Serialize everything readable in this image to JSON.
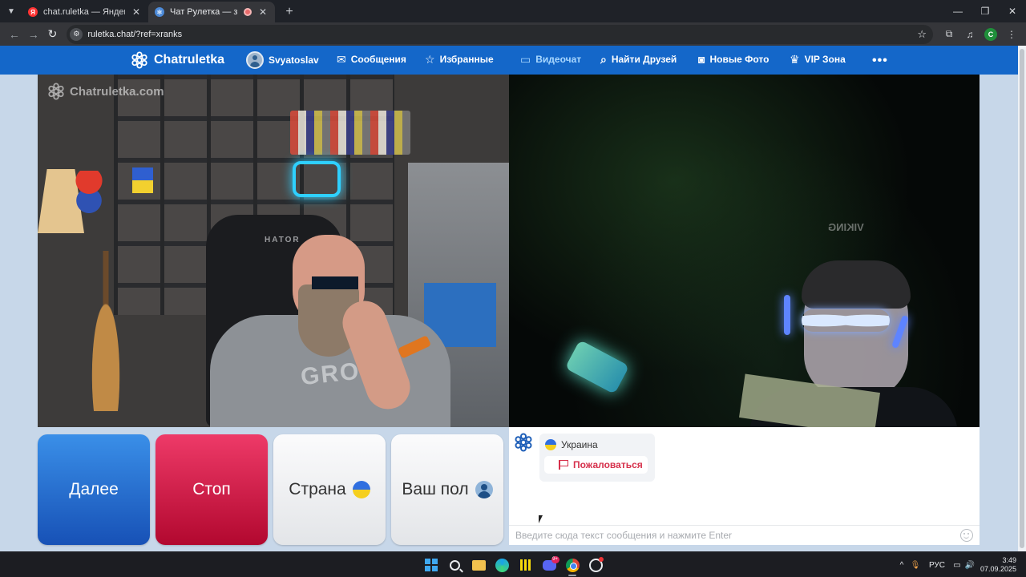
{
  "browser": {
    "tabs": [
      {
        "title": "chat.ruletka — Яндекс: нашлось",
        "active": false,
        "favicon": "yandex-icon"
      },
      {
        "title": "Чат Рулетка — знакомства",
        "active": true,
        "favicon": "chatruletka-icon",
        "recording": true
      }
    ],
    "url": "ruletka.chat/?ref=xranks",
    "profile_letter": "C"
  },
  "site": {
    "brand": "Chatruletka",
    "user_name": "Svyatoslav",
    "nav": [
      {
        "label": "Сообщения",
        "icon": "envelope-icon"
      },
      {
        "label": "Избранные",
        "icon": "star-icon"
      },
      {
        "label": "Видеочат",
        "icon": "video-camera-icon",
        "active": true
      },
      {
        "label": "Найти Друзей",
        "icon": "search-icon"
      },
      {
        "label": "Новые Фото",
        "icon": "camera-icon"
      },
      {
        "label": "VIP Зона",
        "icon": "crown-icon"
      }
    ],
    "more_label": "•••",
    "watermark": "Chatruletka.com",
    "accent_color": "#1467c9"
  },
  "video": {
    "local_overlay": {
      "chair_brand": "HATOR",
      "shirt_print": "GROOT"
    },
    "remote_overlay": {
      "cap_text": "VIKING"
    }
  },
  "controls": {
    "next_label": "Далее",
    "stop_label": "Стоп",
    "country_label": "Страна",
    "gender_label": "Ваш пол",
    "next_color": "#1c5fc8",
    "stop_color": "#d0153f"
  },
  "chat": {
    "partner_country": "Украина",
    "report_label": "Пожаловаться",
    "input_placeholder": "Введите сюда текст сообщения и нажмите Enter",
    "input_value": ""
  },
  "taskbar": {
    "language": "РУС",
    "time": "3:49",
    "date": "07.09.2025",
    "discord_badge": "9+"
  }
}
